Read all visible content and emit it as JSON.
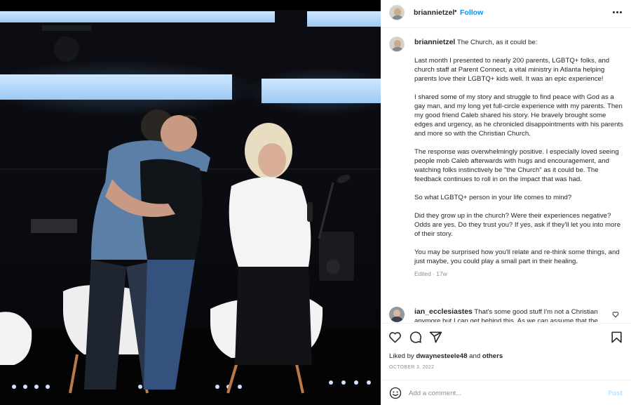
{
  "post": {
    "author": "briannietzel",
    "follow_label": "Follow",
    "separator": "•",
    "caption_lead": "The Church, as it could be:",
    "caption_paragraphs": [
      "Last month I presented to nearly 200 parents, LGBTQ+ folks, and church staff at Parent Connect, a vital ministry in Atlanta helping parents love their LGBTQ+ kids well. It was an epic experience!",
      "I shared some of my story and struggle to find peace with God as a gay man, and my long yet full-circle experience with my parents. Then my good friend Caleb shared his story. He bravely brought some edges and urgency, as he chronicled disappointments with his parents and more so with the Christian Church.",
      "The response was overwhelmingly positive. I especially loved seeing people mob Caleb afterwards with hugs and encouragement, and watching folks instinctively be \"the Church\" as it could be. The feedback continues to roll in on the impact that was had.",
      "So what LGBTQ+ person in your life comes to mind?",
      "Did they grow up in the church? Were their experiences negative? Odds are yes. Do they trust you? If yes, ask if they'll let you into more of their story.",
      "You may be surprised how you'll relate and re-think some things, and just maybe, you could play a small part in their healing."
    ],
    "edited_label": "Edited · 17w"
  },
  "comment": {
    "author": "ian_ecclesiastes",
    "text": "That's some good stuff I'm not a Christian anymore but I can get behind this. As we can assume that the"
  },
  "likes": {
    "prefix": "Liked by",
    "user": "dwaynesteele48",
    "joiner": "and",
    "others": "others"
  },
  "date": "OCTOBER 3, 2022",
  "add_comment": {
    "placeholder": "Add a comment...",
    "post_label": "Post"
  },
  "icons": [
    "more-options-icon",
    "heart-icon",
    "comment-icon",
    "share-icon",
    "save-icon",
    "emoji-icon",
    "comment-like-icon"
  ],
  "colors": {
    "follow": "#0095f6",
    "post_disabled": "#b2dffc",
    "muted": "#8e8e8e",
    "text": "#262626"
  }
}
